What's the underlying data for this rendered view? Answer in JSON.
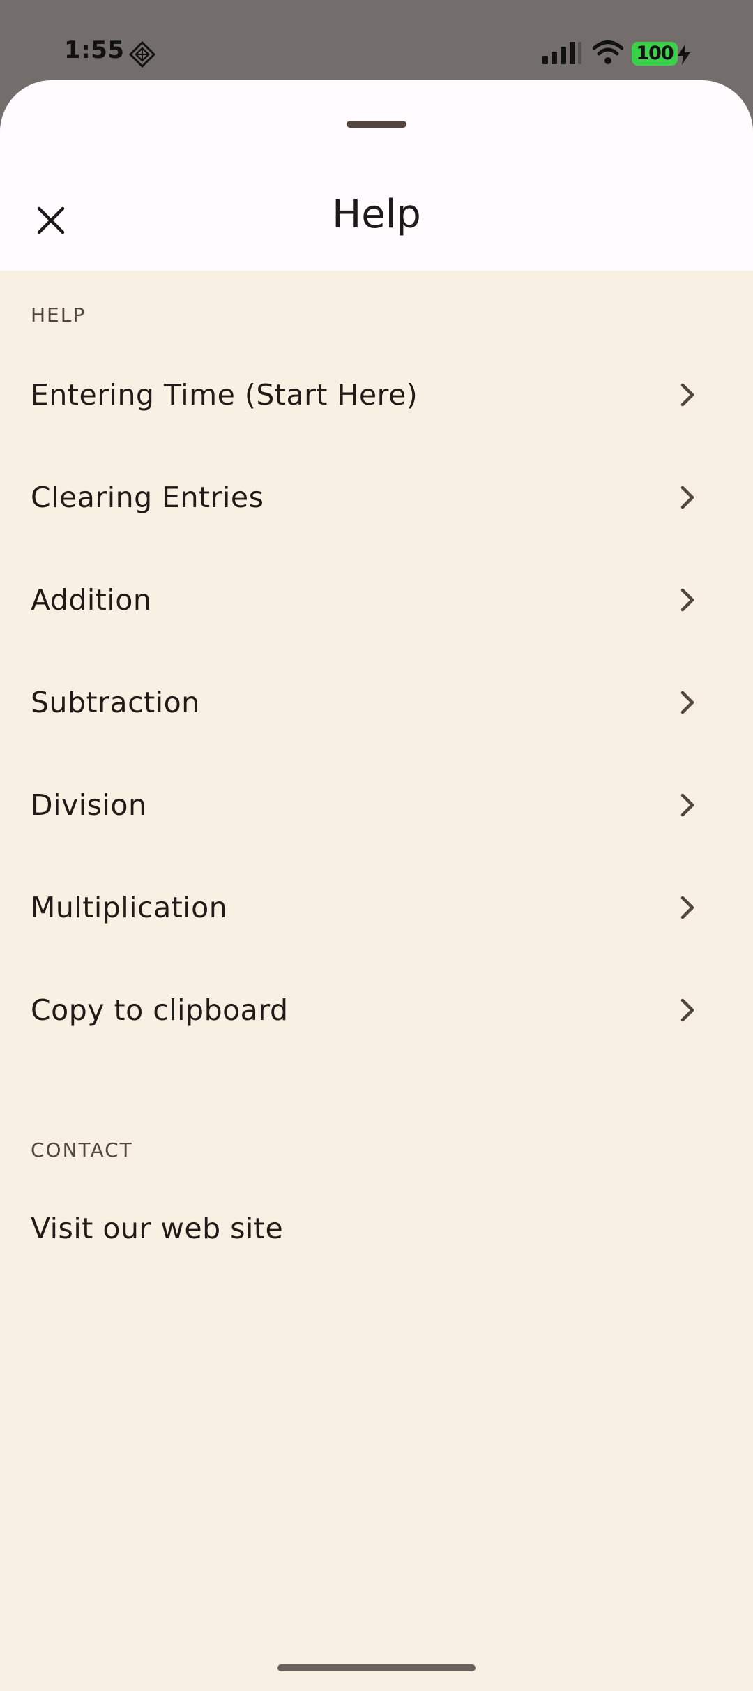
{
  "status_bar": {
    "time": "1:55",
    "battery": "100",
    "icons": [
      "app-notification-icon",
      "cellular-signal-icon",
      "wifi-icon",
      "battery-charging-icon"
    ]
  },
  "sheet": {
    "title": "Help",
    "close_icon": "close-icon"
  },
  "sections": {
    "help": {
      "header": "HELP",
      "items": [
        {
          "label": "Entering Time (Start Here)"
        },
        {
          "label": "Clearing Entries"
        },
        {
          "label": "Addition"
        },
        {
          "label": "Subtraction"
        },
        {
          "label": "Division"
        },
        {
          "label": "Multiplication"
        },
        {
          "label": "Copy to clipboard"
        }
      ]
    },
    "contact": {
      "header": "CONTACT",
      "items": [
        {
          "label": "Visit our web site"
        }
      ]
    }
  },
  "colors": {
    "scrim": "#736e6b",
    "sheet_background": "#f8f0e3",
    "header_background": "#fffbfe",
    "text": "#211a17",
    "section_header": "#54463f",
    "battery": "#39d24a"
  }
}
